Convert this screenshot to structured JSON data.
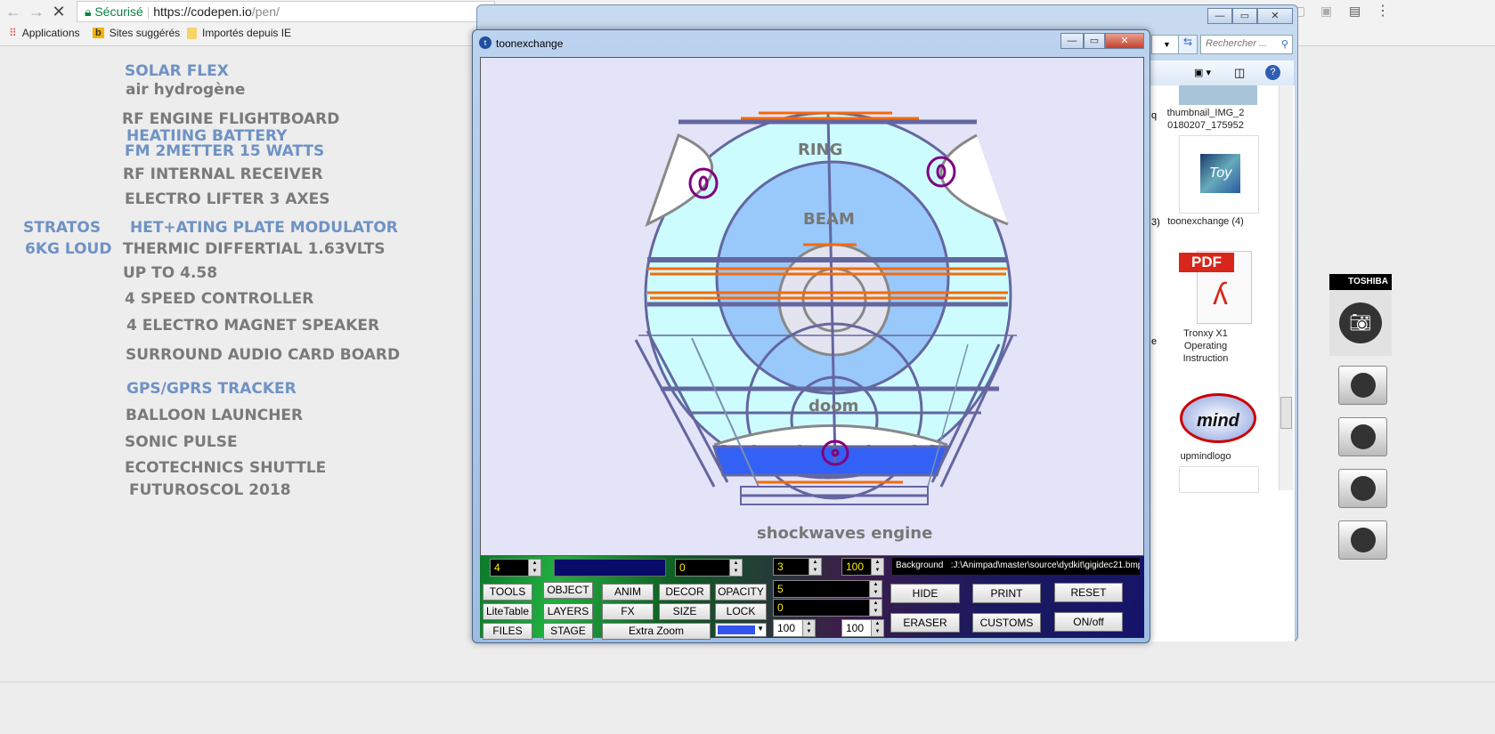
{
  "browser": {
    "secure_label": "Sécurisé",
    "url_host": "https://codepen.io",
    "url_path": "/pen/",
    "bookmarks": [
      {
        "label": "Applications",
        "icon": "apps-grid-icon"
      },
      {
        "label": "Sites suggérés",
        "icon": "bing-icon"
      },
      {
        "label": "Importés depuis IE",
        "icon": "folder-icon"
      }
    ]
  },
  "page_list": {
    "items": [
      {
        "text": "SOLAR FLEX",
        "color": "blue"
      },
      {
        "text": "air hydrogène",
        "color": "gray"
      },
      {
        "text": "RF ENGINE FLIGHTBOARD",
        "color": "gray"
      },
      {
        "text": "HEATIING BATTERY",
        "color": "blue"
      },
      {
        "text": "FM 2METTER 15 WATTS",
        "color": "blue"
      },
      {
        "text": "RF INTERNAL RECEIVER",
        "color": "gray"
      },
      {
        "text": "ELECTRO LIFTER 3 AXES",
        "color": "gray"
      },
      {
        "text": "STRATOS",
        "color": "blue"
      },
      {
        "text": "HET+ATING PLATE MODULATOR",
        "color": "blue"
      },
      {
        "text": "6KG LOUD",
        "color": "blue"
      },
      {
        "text": "THERMIC DIFFERTIAL 1.63VLTS",
        "color": "gray"
      },
      {
        "text": "UP TO 4.58",
        "color": "gray"
      },
      {
        "text": "4 SPEED CONTROLLER",
        "color": "gray"
      },
      {
        "text": "4 ELECTRO MAGNET SPEAKER",
        "color": "gray"
      },
      {
        "text": "SURROUND AUDIO CARD BOARD",
        "color": "gray"
      },
      {
        "text": "GPS/GPRS TRACKER",
        "color": "blue"
      },
      {
        "text": "BALLOON LAUNCHER",
        "color": "gray"
      },
      {
        "text": "SONIC PULSE",
        "color": "gray"
      },
      {
        "text": "ECOTECHNICS SHUTTLE",
        "color": "gray"
      },
      {
        "text": "FUTUROSCOL 2018",
        "color": "gray"
      }
    ]
  },
  "explorer": {
    "search_placeholder": "Rechercher ...",
    "files": [
      {
        "name": "thumbnail_IMG_2\n0180207_175952"
      },
      {
        "name": "toonexchange (4)"
      },
      {
        "name": "Tronxy X1\nOperating\nInstruction",
        "badge": "PDF"
      },
      {
        "name": "upmindlogo"
      }
    ],
    "partial_labels": [
      "q",
      "3)",
      "e"
    ]
  },
  "toshiba": {
    "brand": "TOSHIBA"
  },
  "app": {
    "title": "toonexchange",
    "drawing_labels": {
      "ring": "RING",
      "beam": "BEAM",
      "doom": "doom",
      "caption": "shockwaves engine"
    },
    "panel": {
      "spin_a": "4",
      "spin_b": "0",
      "spin_c": "3",
      "spin_d": "100",
      "background_path": "Background   :J:\\Animpad\\master\\source\\dydkit\\gigidec21.bmp",
      "field_1": "5",
      "field_2": "0",
      "spin_e": "100",
      "spin_f": "100",
      "color_value": "#3355ee",
      "buttons_left": [
        [
          "TOOLS",
          "OBJECT",
          "ANIM",
          "DECOR",
          "OPACITY"
        ],
        [
          "LiteTable",
          "LAYERS",
          "FX",
          "SIZE",
          "LOCK"
        ],
        [
          "FILES",
          "STAGE",
          "Extra Zoom"
        ]
      ],
      "buttons_right": [
        [
          "HIDE",
          "PRINT",
          "RESET"
        ],
        [
          "ERASER",
          "CUSTOMS",
          "ON/off"
        ]
      ]
    }
  }
}
